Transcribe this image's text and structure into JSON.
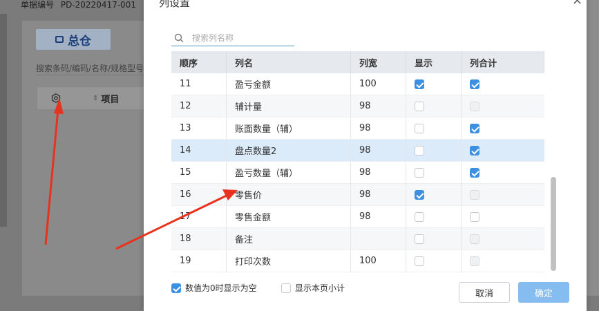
{
  "background": {
    "doc_number_label": "单据编号",
    "doc_number": "PD-20220417-001",
    "warehouse": "总仓",
    "search_hint": "搜索条码/编码/名称/规格型号",
    "table_head_label": "项目",
    "icons": {
      "warehouse": "warehouse-icon",
      "settings": "gear-icon",
      "sort": "sort-icon"
    }
  },
  "modal": {
    "title": "列设置",
    "close_icon": "×",
    "search": {
      "placeholder": "搜索列名称",
      "value": ""
    },
    "columns": {
      "order": "顺序",
      "name": "列名",
      "width": "列宽",
      "show": "显示",
      "sum": "列合计"
    },
    "rows": [
      {
        "order": "11",
        "name": "盈亏金额",
        "width": "100",
        "show": "checked",
        "sum": "checked"
      },
      {
        "order": "12",
        "name": "辅计量",
        "width": "98",
        "show": "unchecked",
        "sum": "disabled"
      },
      {
        "order": "13",
        "name": "账面数量（辅）",
        "width": "98",
        "show": "unchecked",
        "sum": "checked"
      },
      {
        "order": "14",
        "name": "盘点数量2",
        "width": "98",
        "show": "unchecked",
        "sum": "checked"
      },
      {
        "order": "15",
        "name": "盈亏数量（辅）",
        "width": "98",
        "show": "unchecked",
        "sum": "checked"
      },
      {
        "order": "16",
        "name": "零售价",
        "width": "98",
        "show": "checked",
        "sum": "disabled"
      },
      {
        "order": "17",
        "name": "零售金额",
        "width": "98",
        "show": "unchecked",
        "sum": "unchecked"
      },
      {
        "order": "18",
        "name": "备注",
        "width": "",
        "show": "unchecked",
        "sum": "disabled"
      },
      {
        "order": "19",
        "name": "打印次数",
        "width": "100",
        "show": "unchecked",
        "sum": "disabled"
      }
    ],
    "selected_row_order": "14",
    "options": {
      "zero_blank": {
        "label": "数值为0时显示为空",
        "checked": true
      },
      "page_subtotal": {
        "label": "显示本页小计",
        "checked": false
      }
    },
    "buttons": {
      "cancel": "取消",
      "ok": "确定"
    }
  },
  "colors": {
    "accent": "#3d8fe0",
    "selected_row": "#dcebfa",
    "annotation": "#e8321e"
  }
}
